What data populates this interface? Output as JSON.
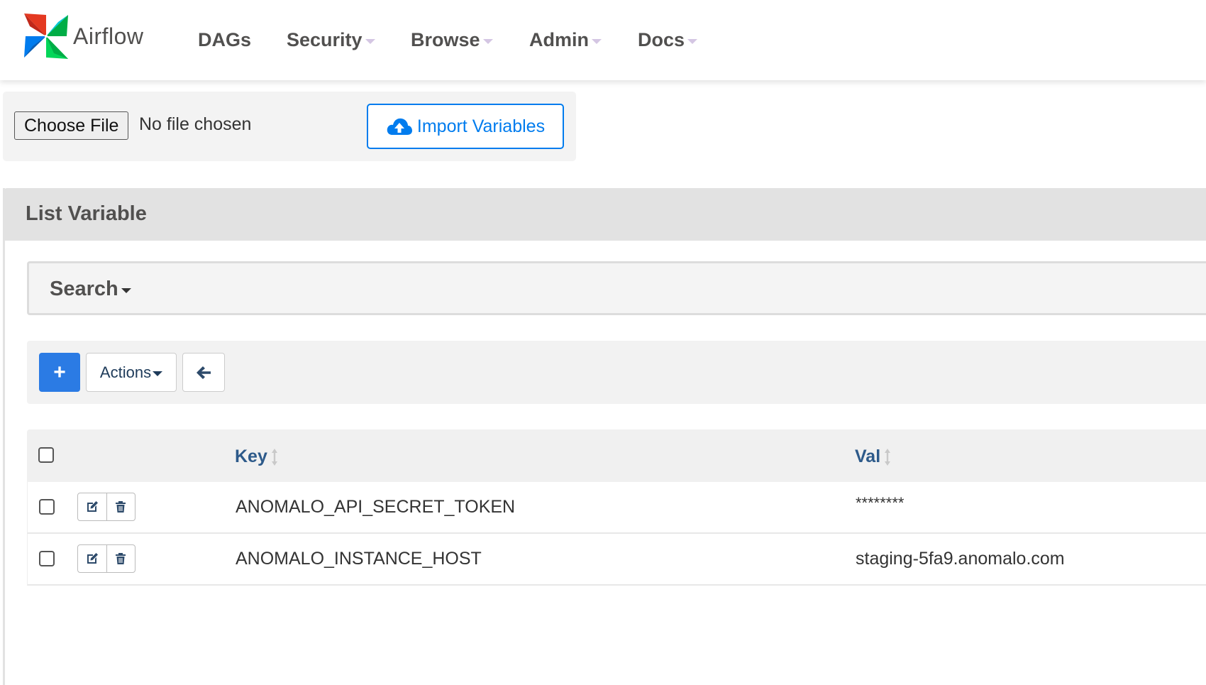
{
  "navbar": {
    "brand": "Airflow",
    "items": [
      {
        "label": "DAGs",
        "has_dropdown": false
      },
      {
        "label": "Security",
        "has_dropdown": true
      },
      {
        "label": "Browse",
        "has_dropdown": true
      },
      {
        "label": "Admin",
        "has_dropdown": true
      },
      {
        "label": "Docs",
        "has_dropdown": true
      }
    ]
  },
  "import_panel": {
    "choose_file_label": "Choose File",
    "file_status": "No file chosen",
    "import_button_label": "Import Variables",
    "import_icon": "cloud-upload-icon"
  },
  "list_panel": {
    "title": "List Variable",
    "search_label": "Search",
    "toolbar": {
      "add_label": "+",
      "actions_label": "Actions",
      "back_icon": "arrow-left-icon"
    },
    "table": {
      "columns": [
        {
          "label": "Key",
          "sortable": true
        },
        {
          "label": "Val",
          "sortable": true
        }
      ],
      "rows": [
        {
          "key": "ANOMALO_API_SECRET_TOKEN",
          "val": "********"
        },
        {
          "key": "ANOMALO_INSTANCE_HOST",
          "val": "staging-5fa9.anomalo.com"
        }
      ]
    }
  },
  "colors": {
    "brand_blue": "#017cee",
    "primary_button": "#2b7be4",
    "header_text": "#2d5a8a"
  }
}
